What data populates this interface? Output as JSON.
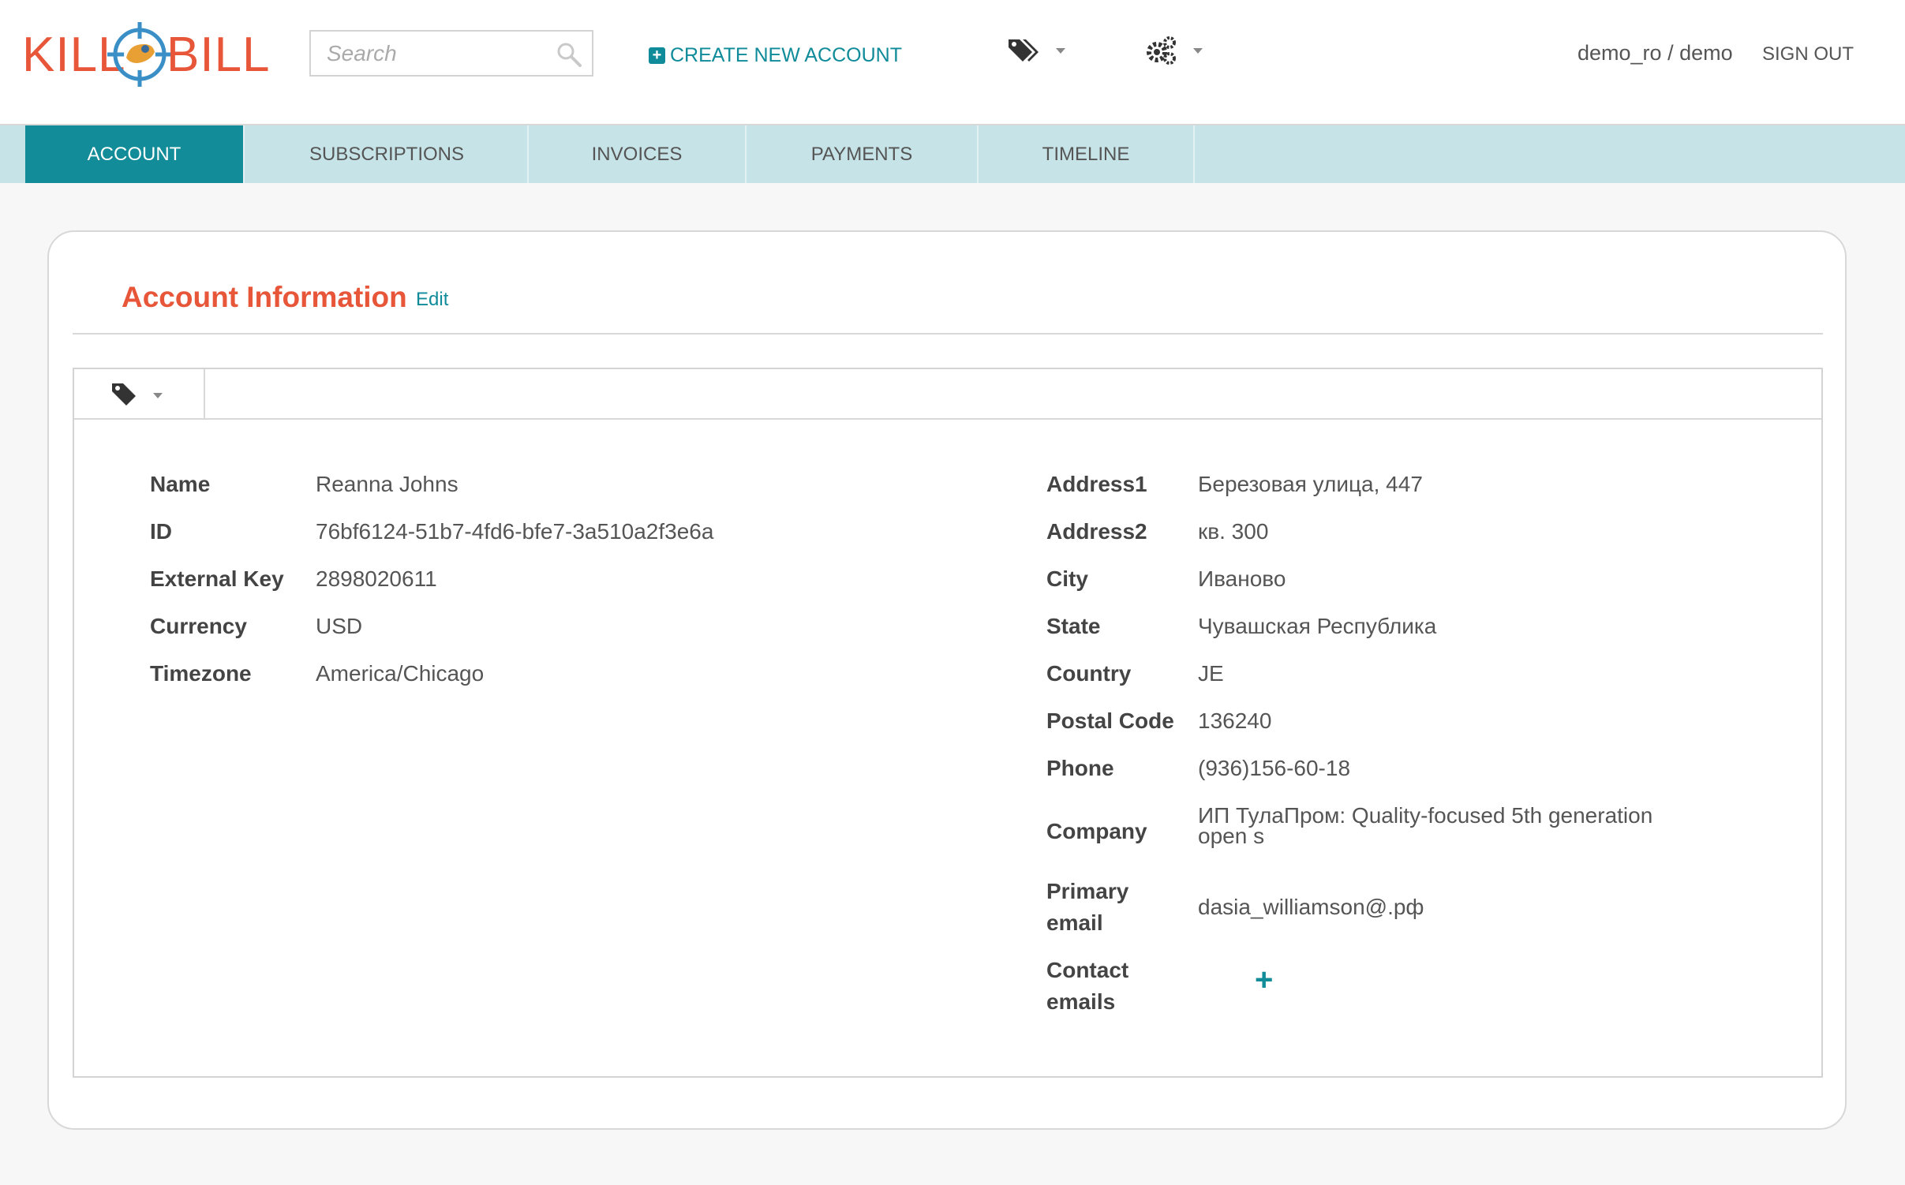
{
  "header": {
    "logo_left": "KILL",
    "logo_right": "BILL",
    "search": {
      "placeholder": "Search",
      "value": ""
    },
    "create_account_label": "CREATE NEW ACCOUNT",
    "tags_icon": "tags-icon",
    "settings_icon": "gears-icon",
    "user_label": "demo_ro / demo",
    "signout_label": "SIGN OUT"
  },
  "nav": {
    "tabs": [
      {
        "label": "ACCOUNT",
        "active": true
      },
      {
        "label": "SUBSCRIPTIONS",
        "active": false
      },
      {
        "label": "INVOICES",
        "active": false
      },
      {
        "label": "PAYMENTS",
        "active": false
      },
      {
        "label": "TIMELINE",
        "active": false
      }
    ]
  },
  "panel": {
    "title": "Account Information",
    "edit_label": "Edit"
  },
  "account": {
    "left": [
      {
        "label": "Name",
        "value": "Reanna Johns"
      },
      {
        "label": "ID",
        "value": "76bf6124-51b7-4fd6-bfe7-3a510a2f3e6a"
      },
      {
        "label": "External Key",
        "value": "2898020611"
      },
      {
        "label": "Currency",
        "value": "USD"
      },
      {
        "label": "Timezone",
        "value": "America/Chicago"
      }
    ],
    "right": [
      {
        "label": "Address1",
        "value": "Березовая улица, 447"
      },
      {
        "label": "Address2",
        "value": "кв. 300"
      },
      {
        "label": "City",
        "value": "Иваново"
      },
      {
        "label": "State",
        "value": "Чувашская Республика"
      },
      {
        "label": "Country",
        "value": "JE"
      },
      {
        "label": "Postal Code",
        "value": "136240"
      },
      {
        "label": "Phone",
        "value": "(936)156-60-18"
      },
      {
        "label": "Company",
        "value_line1": "ИП ТулаПром: Quality-focused 5th generation",
        "value_line2": "open s"
      },
      {
        "label_line1": "Primary",
        "label_line2": "email",
        "value": "dasia_williamson@.рф"
      },
      {
        "label_line1": "Contact",
        "label_line2": "emails",
        "value": "+"
      }
    ]
  },
  "colors": {
    "brand_orange": "#e8563a",
    "accent_teal": "#118c98",
    "nav_bg": "#c6e3e7"
  }
}
